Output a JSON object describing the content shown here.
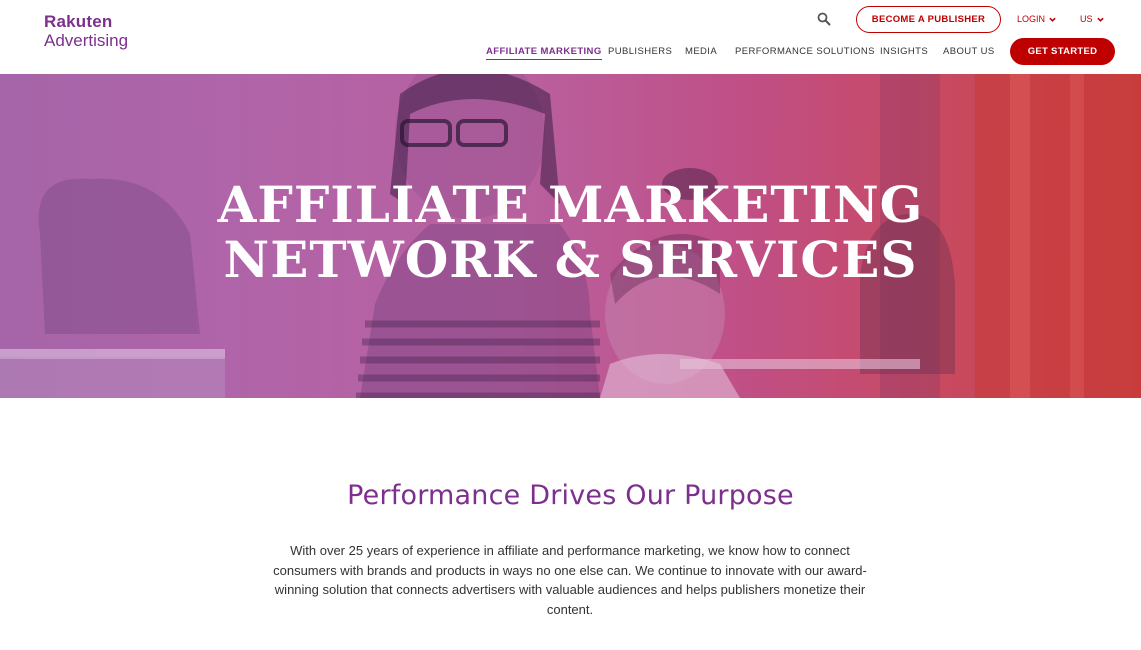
{
  "brand": {
    "line1": "Rakuten",
    "line2": "Advertising",
    "color": "#7d2f8e"
  },
  "header": {
    "search_icon": "search-icon",
    "become_publisher": "BECOME A PUBLISHER",
    "login": "LOGIN",
    "region": "US",
    "get_started": "GET STARTED",
    "accent": "#bf0000"
  },
  "nav": {
    "items": [
      "AFFILIATE MARKETING",
      "PUBLISHERS",
      "MEDIA",
      "PERFORMANCE SOLUTIONS",
      "INSIGHTS",
      "ABOUT US"
    ],
    "active": "AFFILIATE MARKETING"
  },
  "hero": {
    "title_line1": "AFFILIATE MARKETING",
    "title_line2": "NETWORK & SERVICES"
  },
  "content": {
    "title": "Performance Drives Our Purpose",
    "paragraph": "With over 25 years of experience in affiliate and performance marketing, we know how to connect consumers with brands and products in ways no one else can. We continue to innovate with our award-winning solution that connects advertisers with valuable audiences and helps publishers monetize their content."
  }
}
